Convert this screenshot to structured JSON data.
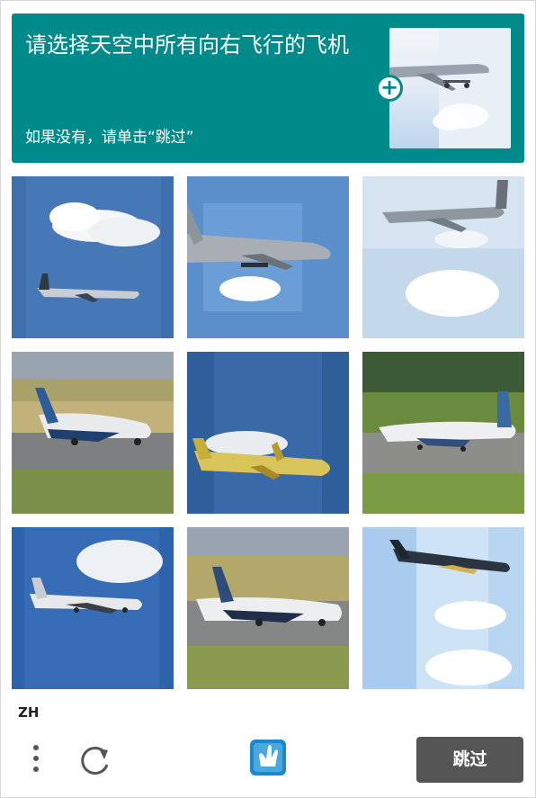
{
  "header": {
    "prompt": "请选择天空中所有向右飞行的飞机",
    "hint": "如果没有，请单击“跳过”",
    "sample_image": "airplane-sample",
    "expand_icon": "plus-icon"
  },
  "colors": {
    "accent": "#008a8a",
    "button": "#555555"
  },
  "grid": {
    "tiles": [
      {
        "image": "airplane-blue-sky-with-cloud"
      },
      {
        "image": "airplane-blue-sky-large"
      },
      {
        "image": "airplane-pale-sky-with-cloud"
      },
      {
        "image": "airplane-on-runway-grass"
      },
      {
        "image": "yellow-airplane-blue-sky"
      },
      {
        "image": "airplane-on-runway-trees"
      },
      {
        "image": "airplane-blue-sky-cloud-top"
      },
      {
        "image": "airplane-on-runway-field"
      },
      {
        "image": "airplane-light-sky-clouds"
      }
    ]
  },
  "footer": {
    "language": "ZH",
    "menu_icon": "more-vertical-icon",
    "refresh_icon": "refresh-icon",
    "logo_icon": "hand-logo-icon",
    "skip_label": "跳过"
  }
}
